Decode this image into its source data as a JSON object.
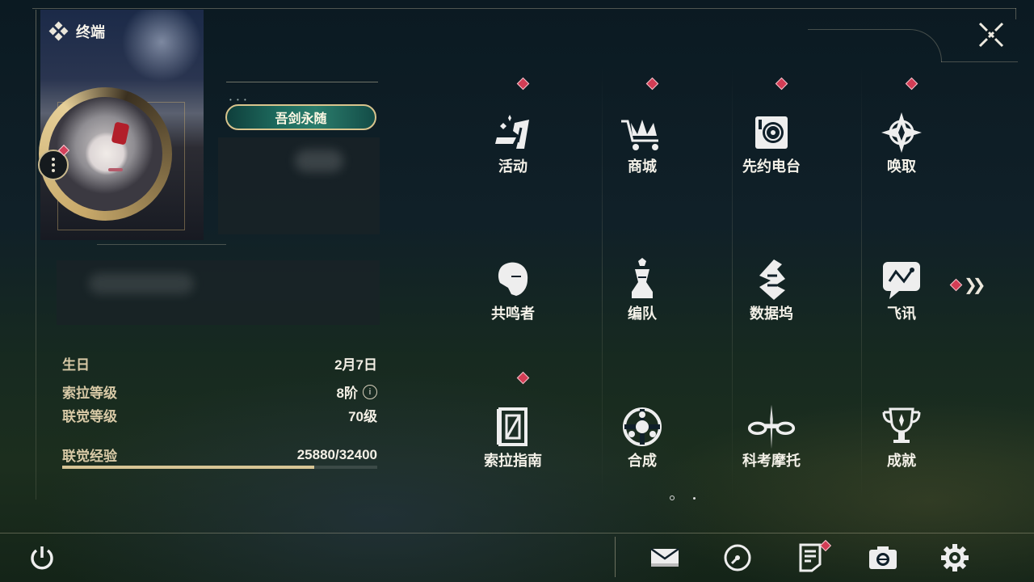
{
  "header": {
    "title": "终端"
  },
  "profile": {
    "title_badge": "吾剑永随",
    "stats": [
      {
        "label": "生日",
        "value": "2月7日"
      },
      {
        "label": "索拉等级",
        "value": "8阶"
      },
      {
        "label": "联觉等级",
        "value": "70级"
      }
    ],
    "experience": {
      "label": "联觉经验",
      "value": "25880/32400",
      "progress": 0.7988
    }
  },
  "menu": {
    "items": [
      {
        "label": "活动",
        "icon": "event-icon",
        "badge": true
      },
      {
        "label": "商城",
        "icon": "shop-cart-icon",
        "badge": true
      },
      {
        "label": "先约电台",
        "icon": "radio-icon",
        "badge": true
      },
      {
        "label": "唤取",
        "icon": "compass-star-icon",
        "badge": true
      },
      {
        "label": "共鸣者",
        "icon": "resonator-icon",
        "badge": false
      },
      {
        "label": "编队",
        "icon": "chess-team-icon",
        "badge": false
      },
      {
        "label": "数据坞",
        "icon": "data-bank-icon",
        "badge": false
      },
      {
        "label": "飞讯",
        "icon": "chat-message-icon",
        "badge": false
      },
      {
        "label": "索拉指南",
        "icon": "guide-book-icon",
        "badge": true
      },
      {
        "label": "合成",
        "icon": "synthesis-icon",
        "badge": false
      },
      {
        "label": "科考摩托",
        "icon": "motorcycle-icon",
        "badge": false
      },
      {
        "label": "成就",
        "icon": "trophy-icon",
        "badge": false
      }
    ],
    "pages": {
      "current": 1,
      "total": 2
    }
  },
  "bottom_bar": {
    "left": [
      {
        "name": "power-icon"
      }
    ],
    "right": [
      {
        "name": "mail-icon",
        "badge": false
      },
      {
        "name": "clock-icon",
        "badge": false
      },
      {
        "name": "notes-icon",
        "badge": true
      },
      {
        "name": "camera-icon",
        "badge": false
      },
      {
        "name": "settings-gear-icon",
        "badge": false
      }
    ]
  },
  "colors": {
    "accent_gold": "#d7c595",
    "badge_red": "#d33d55",
    "text_light": "#f4f1e8",
    "label_gold": "#d8c9a6"
  }
}
